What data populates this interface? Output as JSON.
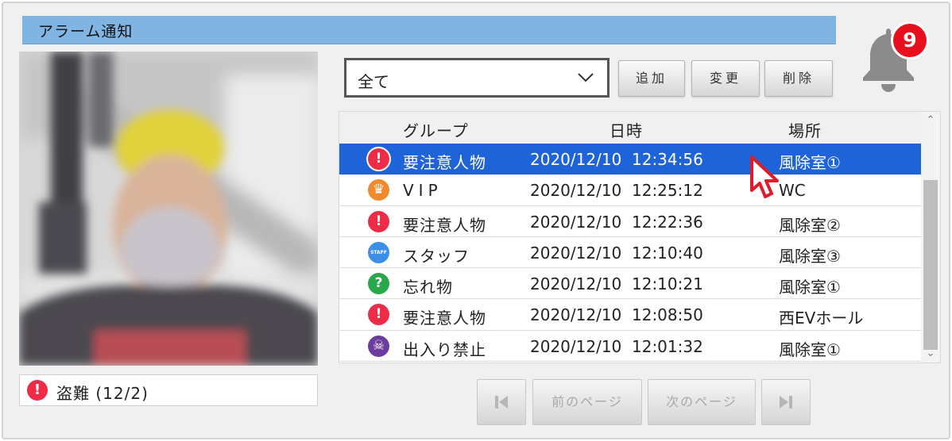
{
  "header": {
    "title": "アラーム通知"
  },
  "notifications": {
    "count": "9",
    "icon": "bell-icon"
  },
  "snapshot": {
    "caption_icon": "!",
    "caption": "盗難 (12/2)"
  },
  "filter": {
    "selected": "全て"
  },
  "toolbar": {
    "add": "追加",
    "edit": "変更",
    "delete": "削除"
  },
  "table": {
    "columns": {
      "group": "グループ",
      "datetime": "日時",
      "place": "場所"
    },
    "rows": [
      {
        "icon": "!",
        "icon_color": "#ee2c47",
        "group": "要注意人物",
        "datetime": "2020/12/10  12:34:56",
        "place": "風除室①"
      },
      {
        "icon": "♛",
        "icon_color": "#f08a2c",
        "group": "VIP",
        "datetime": "2020/12/10  12:25:12",
        "place": "WC"
      },
      {
        "icon": "!",
        "icon_color": "#ee2c47",
        "group": "要注意人物",
        "datetime": "2020/12/10  12:22:36",
        "place": "風除室②"
      },
      {
        "icon": "STAFF",
        "icon_color": "#3b8fe6",
        "group": "スタッフ",
        "datetime": "2020/12/10  12:10:40",
        "place": "風除室③"
      },
      {
        "icon": "?",
        "icon_color": "#27a84a",
        "group": "忘れ物",
        "datetime": "2020/12/10  12:10:21",
        "place": "風除室①"
      },
      {
        "icon": "!",
        "icon_color": "#ee2c47",
        "group": "要注意人物",
        "datetime": "2020/12/10  12:08:50",
        "place": "西EVホール"
      },
      {
        "icon": "☠",
        "icon_color": "#6c3d9c",
        "group": "出入り禁止",
        "datetime": "2020/12/10  12:01:32",
        "place": "風除室①"
      }
    ]
  },
  "pager": {
    "prev": "前のページ",
    "next": "次のページ"
  },
  "colors": {
    "title_bar": "#80b4e2",
    "selection": "#1f63d9",
    "badge": "#e8101e"
  }
}
